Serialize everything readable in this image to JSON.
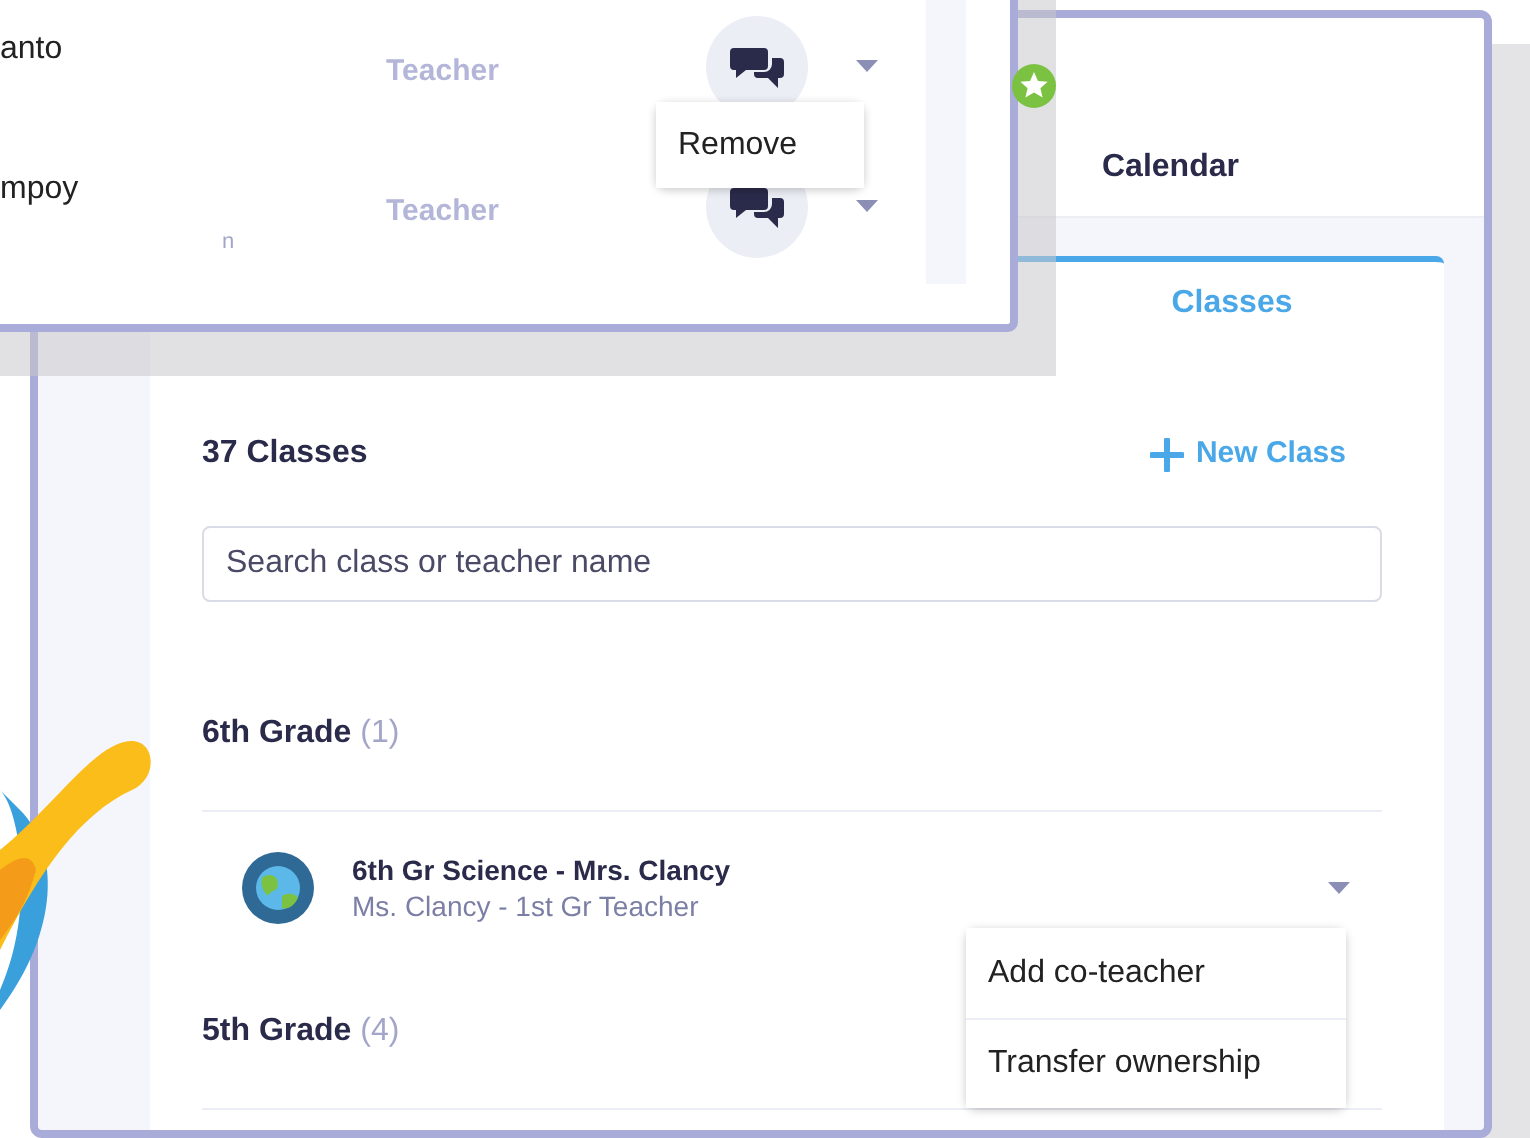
{
  "front_window": {
    "members": [
      {
        "name": "anto",
        "role": "Teacher"
      },
      {
        "name": "mpoy",
        "note": "n",
        "role": "Teacher"
      }
    ],
    "menu": {
      "items": [
        "Remove"
      ]
    }
  },
  "main_window": {
    "nav": {
      "items": [
        {
          "label": "Calendar"
        }
      ]
    },
    "tab": {
      "label": "Classes",
      "selected": true
    },
    "class_count": "37 Classes",
    "new_class_button": "New Class",
    "search": {
      "placeholder": "Search class or teacher name"
    },
    "grades": [
      {
        "title": "6th Grade",
        "count": "(1)",
        "classes": [
          {
            "title": "6th Gr Science - Mrs. Clancy",
            "subtitle": "Ms. Clancy - 1st Gr Teacher"
          }
        ]
      },
      {
        "title": "5th Grade",
        "count": "(4)"
      }
    ],
    "class_menu": {
      "items": [
        "Add co-teacher",
        "Transfer ownership"
      ]
    }
  }
}
